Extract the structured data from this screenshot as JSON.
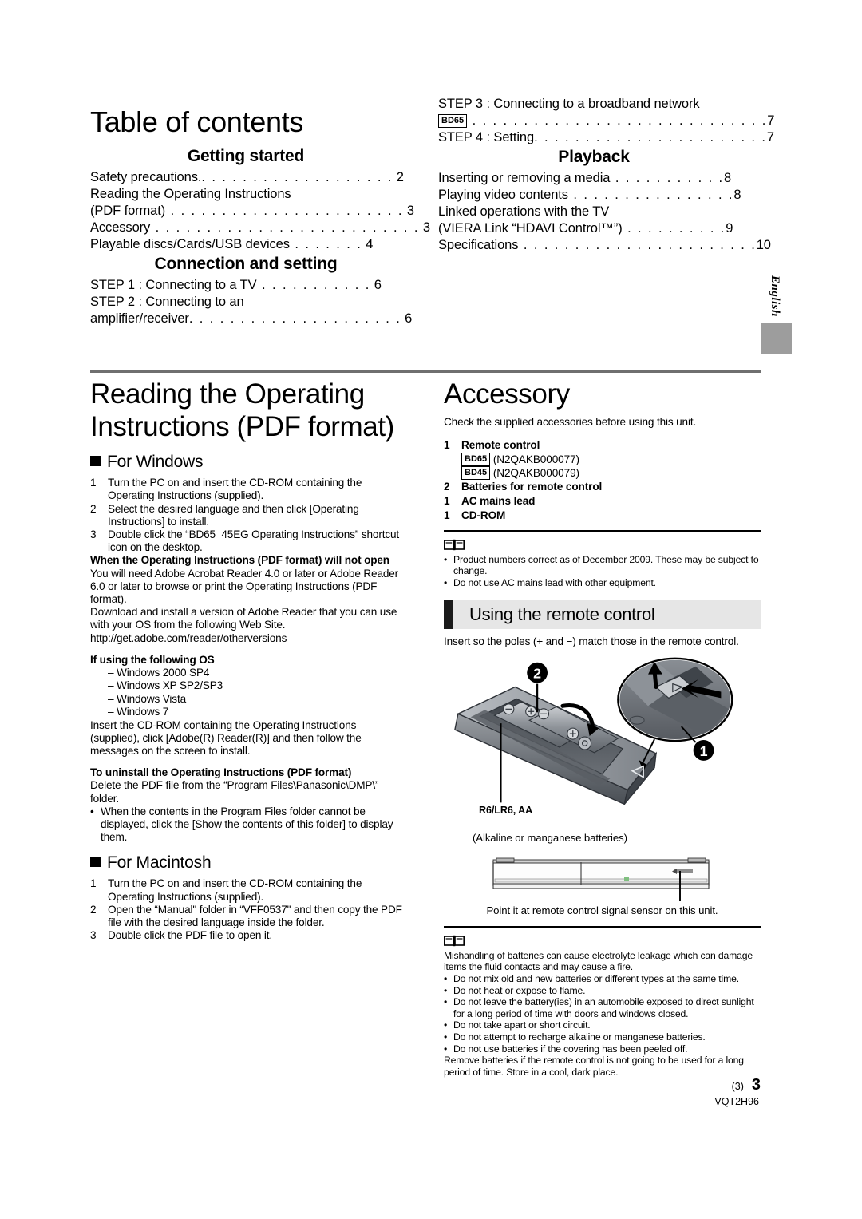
{
  "toc": {
    "title": "Table of contents",
    "left": {
      "sections": [
        {
          "heading": "Getting started",
          "entries": [
            {
              "text": "Safety precautions.",
              "leader": ". . . . . . . . . . . . . . . . . . .",
              "page": "2"
            },
            {
              "text": "Reading the Operating Instructions",
              "leader": "",
              "page": ""
            },
            {
              "text": "(PDF format)",
              "leader": " . . . . . . . . . . . . . . . . . . . . . . .",
              "page": "3"
            },
            {
              "text": "Accessory",
              "leader": " . . . . . . . . . . . . . . . . . . . . . . . . . .",
              "page": "3"
            },
            {
              "text": "Playable discs/Cards/USB devices",
              "leader": " . . . . . . .",
              "page": "4"
            }
          ]
        },
        {
          "heading": "Connection and setting",
          "entries": [
            {
              "text": "STEP 1 : Connecting to a TV",
              "leader": " . . . . . . . . . . .",
              "page": "6"
            },
            {
              "text": "STEP 2 : Connecting to an",
              "leader": "",
              "page": ""
            },
            {
              "text": "amplifier/receiver",
              "leader": ". . . . . . . . . . . . . . . . . . . . .",
              "page": "6"
            }
          ]
        }
      ]
    },
    "right": {
      "pre_entries": [
        {
          "text": "STEP 3 : Connecting to a broadband network",
          "leader": "",
          "page": ""
        },
        {
          "badge": "BD65",
          "text": "",
          "leader": " . . . . . . . . . . . . . . . . . . . . . . . . . . . . .",
          "page": "7"
        },
        {
          "text": "STEP 4 : Setting",
          "leader": ". . . . . . . . . . . . . . . . . . . . . . .",
          "page": "7"
        }
      ],
      "sections": [
        {
          "heading": "Playback",
          "entries": [
            {
              "text": "Inserting or removing a media",
              "leader": " . . . . . . . . . . .",
              "page": "8"
            },
            {
              "text": "Playing video contents",
              "leader": " . . . . . . . . . . . . . . . .",
              "page": "8"
            },
            {
              "text": "Linked operations with the TV",
              "leader": "",
              "page": ""
            },
            {
              "text": "(VIERA Link “HDAVI Control™”)",
              "leader": " . . . . . . . . . .",
              "page": "9"
            },
            {
              "text": "Specifications",
              "leader": " . . . . . . . . . . . . . . . . . . . . . . .",
              "page": "10"
            }
          ]
        }
      ]
    }
  },
  "left_column": {
    "title": "Reading the Operating Instructions (PDF format)",
    "windows_heading": "For Windows",
    "windows_steps": [
      {
        "n": "1",
        "text": "Turn the PC on and insert the CD-ROM containing the Operating Instructions (supplied)."
      },
      {
        "n": "2",
        "text": "Select the desired language and then click [Operating Instructions] to install."
      },
      {
        "n": "3",
        "text": "Double click the “BD65_45EG Operating Instructions” shortcut icon on the desktop."
      }
    ],
    "wont_open_heading": "When the Operating Instructions (PDF format) will not open",
    "wont_open_body_1": "You will need Adobe Acrobat Reader 4.0 or later or Adobe Reader 6.0 or later to browse or print the Operating Instructions (PDF format).",
    "wont_open_body_2": "Download and install a version of Adobe Reader that you can use with your OS from the following Web Site.",
    "wont_open_url": "http://get.adobe.com/reader/otherversions",
    "os_heading": "If using the following OS",
    "os_list": [
      "– Windows 2000 SP4",
      "– Windows XP SP2/SP3",
      "– Windows Vista",
      "– Windows 7"
    ],
    "os_body": "Insert the CD-ROM containing the Operating Instructions (supplied), click [Adobe(R) Reader(R)] and then follow the messages on the screen to install.",
    "uninstall_heading": "To uninstall the Operating Instructions (PDF format)",
    "uninstall_body": "Delete the PDF file from the “Program Files\\Panasonic\\DMP\\” folder.",
    "uninstall_bullet": "When the contents in the Program Files folder cannot be displayed, click the [Show the contents of this folder] to display them.",
    "macintosh_heading": "For Macintosh",
    "macintosh_steps": [
      {
        "n": "1",
        "text": "Turn the PC on and insert the CD-ROM containing the Operating Instructions (supplied)."
      },
      {
        "n": "2",
        "text": "Open the “Manual\" folder in “VFF0537\" and then copy the PDF file with the desired language inside the folder."
      },
      {
        "n": "3",
        "text": "Double click the PDF file to open it."
      }
    ]
  },
  "right_column": {
    "accessory_title": "Accessory",
    "accessory_intro": "Check the supplied accessories before using this unit.",
    "accessory_items": [
      {
        "n": "1",
        "label": "Remote control",
        "sub": [
          {
            "badge": "BD65",
            "text": "(N2QAKB000077)"
          },
          {
            "badge": "BD45",
            "text": "(N2QAKB000079)"
          }
        ]
      },
      {
        "n": "2",
        "label": "Batteries for remote control",
        "sub": []
      },
      {
        "n": "1",
        "label": "AC mains lead",
        "sub": []
      },
      {
        "n": "1",
        "label": "CD-ROM",
        "sub": []
      }
    ],
    "accessory_notes": [
      "Product numbers correct as of December 2009. These may be subject to change.",
      "Do not use AC mains lead with other equipment."
    ],
    "remote_band_title": "Using the remote control",
    "remote_intro": "Insert so the poles (+ and −) match those in the remote control.",
    "battery_label": "R6/LR6, AA",
    "battery_sublabel": "(Alkaline or manganese batteries)",
    "callout_1": "1",
    "callout_2": "2",
    "point_caption": "Point it at remote control signal sensor on this unit.",
    "battery_note_intro": "Mishandling of batteries can cause electrolyte leakage which can damage items the fluid contacts and may cause a fire.",
    "battery_note_bullets": [
      "Do not mix old and new batteries or different types at the same time.",
      "Do not heat or expose to flame.",
      "Do not leave the battery(ies) in an automobile exposed to direct sunlight for a long period of time with doors and windows closed.",
      "Do not take apart or short circuit.",
      "Do not attempt to recharge alkaline or manganese batteries.",
      "Do not use batteries if the covering has been peeled off."
    ],
    "battery_note_outro": "Remove batteries if the remote control is not going to be used for a long period of time. Store in a cool, dark place."
  },
  "side_tab": {
    "label": "English"
  },
  "footer": {
    "paren": "(3)",
    "page_number": "3",
    "doc_code": "VQT2H96"
  },
  "colors": {
    "rule": "#6f6f6f",
    "band_bg": "#e6e6e6",
    "band_bar": "#1a1a1a",
    "swatch": "#9d9d9d"
  }
}
